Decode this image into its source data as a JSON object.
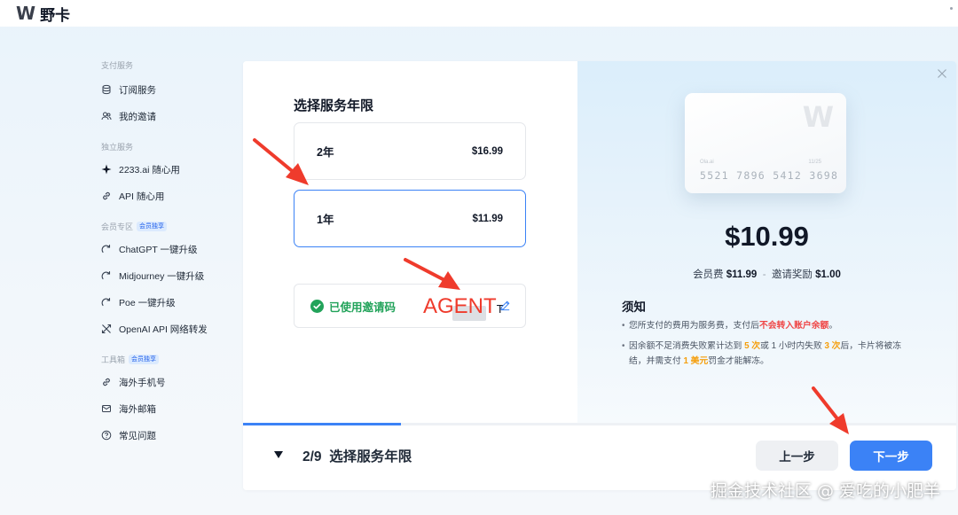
{
  "app": {
    "logo_mark": "W",
    "name": "野卡"
  },
  "sidebar": {
    "sections": [
      {
        "title": "支付服务",
        "badge": "",
        "items": [
          {
            "label": "订阅服务",
            "icon": "money-stack-icon"
          },
          {
            "label": "我的邀请",
            "icon": "users-icon"
          }
        ]
      },
      {
        "title": "独立服务",
        "badge": "",
        "items": [
          {
            "label": "2233.ai 随心用",
            "icon": "sparkle-icon"
          },
          {
            "label": "API 随心用",
            "icon": "link-icon"
          }
        ]
      },
      {
        "title": "会员专区",
        "badge": "会员独享",
        "items": [
          {
            "label": "ChatGPT 一键升级",
            "icon": "upgrade-icon"
          },
          {
            "label": "Midjourney 一键升级",
            "icon": "upgrade-icon"
          },
          {
            "label": "Poe 一键升级",
            "icon": "upgrade-icon"
          },
          {
            "label": "OpenAI API 网络转发",
            "icon": "forward-icon"
          }
        ]
      },
      {
        "title": "工具箱",
        "badge": "会员独享",
        "items": [
          {
            "label": "海外手机号",
            "icon": "link-icon"
          },
          {
            "label": "海外邮箱",
            "icon": "mail-icon"
          },
          {
            "label": "常见问题",
            "icon": "help-icon"
          }
        ]
      }
    ]
  },
  "main": {
    "section_title": "选择服务年限",
    "options": [
      {
        "label": "2年",
        "price": "$16.99",
        "selected": false
      },
      {
        "label": "1年",
        "price": "$11.99",
        "selected": true
      }
    ],
    "invite": {
      "status": "已使用邀请码",
      "code_overlay": "AGENT",
      "code_suffix": "T"
    }
  },
  "card_preview": {
    "logo": "W",
    "brand": "Ola.ai",
    "expiry": "11/25",
    "number": "5521  7896  5412  3698"
  },
  "pricing": {
    "total": "$10.99",
    "member_fee_label": "会员费",
    "member_fee": "$11.99",
    "separator": "-",
    "invite_reward_label": "邀请奖励",
    "invite_reward": "$1.00"
  },
  "notice": {
    "title": "须知",
    "line1_a": "您所支付的费用为服务费，支付后",
    "line1_hl": "不会转入账户余额",
    "line1_b": "。",
    "line2_a": "因余额不足消费失败累计达到 ",
    "line2_hl1": "5 次",
    "line2_b": "或 1 小时内失败 ",
    "line2_hl2": "3 次",
    "line2_c": "后，卡片将被冻结，并需支付 ",
    "line2_hl3": "1 美元",
    "line2_d": "罚金才能解冻。"
  },
  "footer": {
    "step_current": "2/9",
    "step_title": "选择服务年限",
    "progress": 0.222,
    "prev_label": "上一步",
    "next_label": "下一步"
  },
  "watermark": "掘金技术社区 @ 爱吃的小肥羊",
  "colors": {
    "accent": "#3b82f6",
    "success": "#22a35a",
    "arrow": "#ef3b2c",
    "warn_red": "#ef4444",
    "warn_orange": "#f59e0b"
  }
}
